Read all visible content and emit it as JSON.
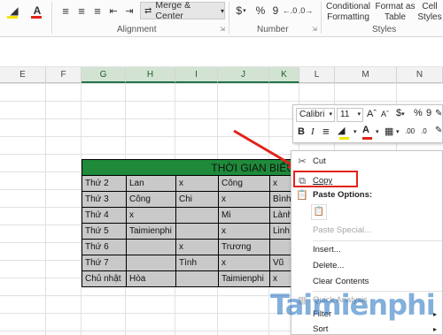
{
  "ribbon": {
    "merge_center_label": "Merge & Center",
    "currency_symbol": "$",
    "percent_symbol": "%",
    "comma_symbol": "9",
    "conditional_formatting_line1": "Conditional",
    "conditional_formatting_line2": "Formatting",
    "format_as_table_line1": "Format as",
    "format_as_table_line2": "Table",
    "cell_styles_line1": "Cell",
    "cell_styles_line2": "Styles",
    "group_alignment": "Alignment",
    "group_number": "Number",
    "group_styles": "Styles",
    "colors": {
      "font_color": "#e2231a",
      "ribbon_bg": "#fbfbfb"
    }
  },
  "columns": [
    "E",
    "F",
    "G",
    "H",
    "I",
    "J",
    "K",
    "L",
    "M",
    "N"
  ],
  "table": {
    "title": "THỜI GIAN BIỂU",
    "rows": [
      [
        "Thứ 2",
        "Lan",
        "x",
        "Công",
        "x"
      ],
      [
        "Thứ 3",
        "Công",
        "Chi",
        "x",
        "Bình"
      ],
      [
        "Thứ 4",
        "x",
        "",
        "Mi",
        "Lành"
      ],
      [
        "Thứ 5",
        "Taimienphi",
        "",
        "x",
        "Linh"
      ],
      [
        "Thứ 6",
        "",
        "x",
        "Trương",
        ""
      ],
      [
        "Thứ 7",
        "",
        "Tình",
        "x",
        "Vũ"
      ],
      [
        "Chủ nhật",
        "Hòa",
        "",
        "Taimienphi",
        "x"
      ]
    ]
  },
  "mini_toolbar": {
    "font_name": "Calibri",
    "font_size": "11",
    "bold": "B",
    "italic": "I",
    "currency": "$",
    "percent": "%",
    "comma": "9"
  },
  "context_menu": {
    "cut": "Cut",
    "copy": "Copy",
    "paste_options": "Paste Options:",
    "paste_special": "Paste Special...",
    "insert": "Insert...",
    "delete": "Delete...",
    "clear_contents": "Clear Contents",
    "quick_analysis": "Quick Analysis",
    "filter": "Filter",
    "sort": "Sort"
  },
  "watermark": "Taimienphi",
  "colors": {
    "header_green": "#1e8a3a",
    "highlight_red": "#e2231a",
    "cell_gray": "#c9c9c9"
  }
}
